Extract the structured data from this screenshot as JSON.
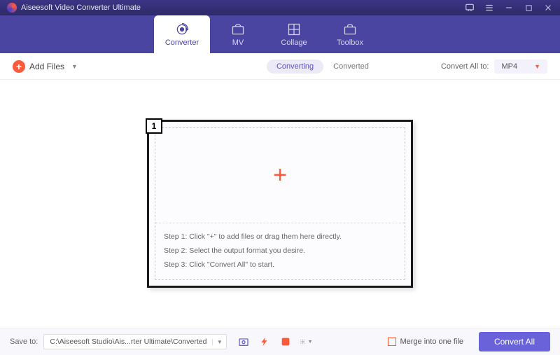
{
  "app": {
    "title": "Aiseesoft Video Converter Ultimate"
  },
  "tabs": {
    "converter": "Converter",
    "mv": "MV",
    "collage": "Collage",
    "toolbox": "Toolbox"
  },
  "toolbar": {
    "add_files": "Add Files",
    "converting": "Converting",
    "converted": "Converted",
    "convert_all_to": "Convert All to:",
    "format": "MP4"
  },
  "dropzone": {
    "marker": "1",
    "step1": "Step 1: Click \"+\" to add files or drag them here directly.",
    "step2": "Step 2: Select the output format you desire.",
    "step3": "Step 3: Click \"Convert All\" to start."
  },
  "footer": {
    "save_to": "Save to:",
    "path": "C:\\Aiseesoft Studio\\Ais...rter Ultimate\\Converted",
    "merge": "Merge into one file",
    "convert_all": "Convert All"
  }
}
